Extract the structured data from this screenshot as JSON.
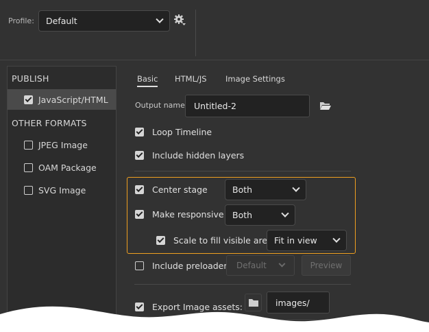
{
  "profile": {
    "label": "Profile:",
    "selected": "Default",
    "settings_icon": "gear-icon"
  },
  "left_panel": {
    "publish_heading": "PUBLISH",
    "publish_items": [
      {
        "label": "JavaScript/HTML",
        "checked": true,
        "selected": true
      }
    ],
    "other_heading": "OTHER FORMATS",
    "other_items": [
      {
        "label": "JPEG Image",
        "checked": false
      },
      {
        "label": "OAM Package",
        "checked": false
      },
      {
        "label": "SVG Image",
        "checked": false
      }
    ]
  },
  "tabs": [
    {
      "label": "Basic",
      "active": true
    },
    {
      "label": "HTML/JS",
      "active": false
    },
    {
      "label": "Image Settings",
      "active": false
    }
  ],
  "basic": {
    "output_label": "Output name:",
    "output_value": "Untitled-2",
    "output_browse_icon": "folder-open-icon",
    "loop_timeline": {
      "label": "Loop Timeline",
      "checked": true
    },
    "include_hidden": {
      "label": "Include hidden layers",
      "checked": true
    },
    "center_stage": {
      "label": "Center stage",
      "checked": true,
      "value": "Both"
    },
    "make_responsive": {
      "label": "Make responsive",
      "checked": true,
      "value": "Both"
    },
    "scale_fill": {
      "label": "Scale to fill visible area",
      "checked": true,
      "value": "Fit in view"
    },
    "include_preloader": {
      "label": "Include preloader",
      "checked": false,
      "value": "Default",
      "preview_label": "Preview"
    },
    "export_images": {
      "label": "Export Image assets:",
      "checked": true,
      "folder_icon": "folder-icon",
      "value": "images/"
    }
  },
  "colors": {
    "background": "#323232",
    "highlight": "#f0a020",
    "selected_row": "#4a4a4a"
  }
}
